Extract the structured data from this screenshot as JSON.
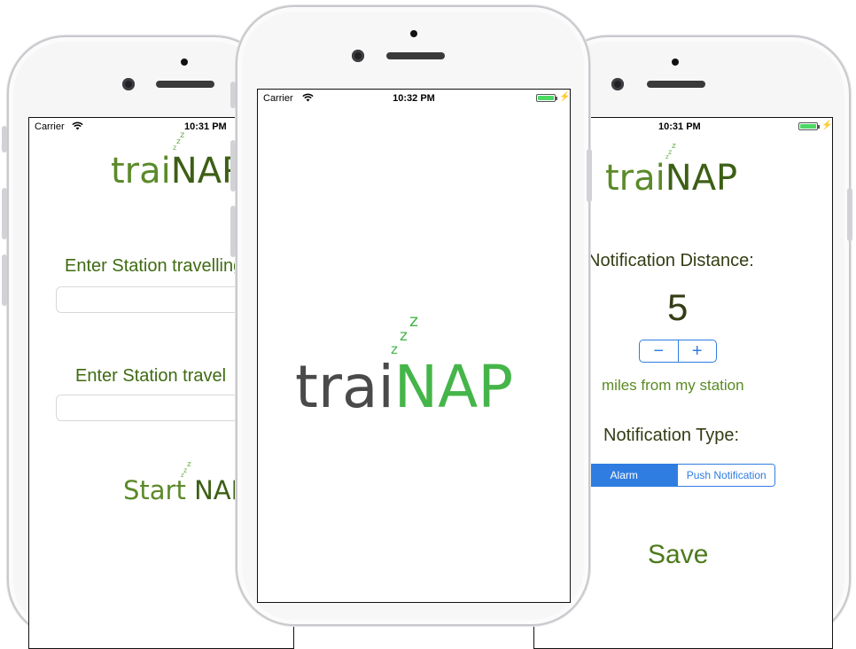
{
  "colors": {
    "dark_green": "#3f6b12",
    "logo_dark": "#4a4a4a",
    "logo_green": "#45b549",
    "accent_blue": "#2f7de1",
    "battery": "#4cd964"
  },
  "left_phone": {
    "status": {
      "carrier": "Carrier",
      "wifi_icon": "wifi-icon",
      "time": "10:31 PM"
    },
    "logo": {
      "prefix": "trai",
      "suffix": "NAP",
      "zzz": [
        "z",
        "z",
        "z"
      ]
    },
    "from_label": "Enter Station travelling",
    "to_label": "Enter Station travel",
    "start": {
      "prefix": "Start ",
      "suffix": "NAP",
      "zzz": [
        "z",
        "z",
        "z"
      ]
    }
  },
  "center_phone": {
    "status": {
      "carrier": "Carrier",
      "wifi_icon": "wifi-icon",
      "time": "10:32 PM",
      "battery_icon": "battery-icon",
      "bolt": "⚡"
    },
    "logo": {
      "prefix": "trai",
      "suffix": "NAP",
      "zzz": [
        "z",
        "z",
        "z"
      ]
    }
  },
  "right_phone": {
    "status": {
      "time": "10:31 PM",
      "battery_icon": "battery-icon",
      "bolt": "⚡"
    },
    "logo": {
      "prefix": "trai",
      "suffix": "NAP",
      "zzz": [
        "z",
        "z",
        "z"
      ]
    },
    "distance_label": "Notification Distance:",
    "distance_value": "5",
    "stepper": {
      "minus": "−",
      "plus": "+"
    },
    "units_label": "miles from my station",
    "type_label": "Notification Type:",
    "segments": {
      "alarm": "Alarm",
      "push": "Push Notification"
    },
    "save_label": "Save"
  }
}
